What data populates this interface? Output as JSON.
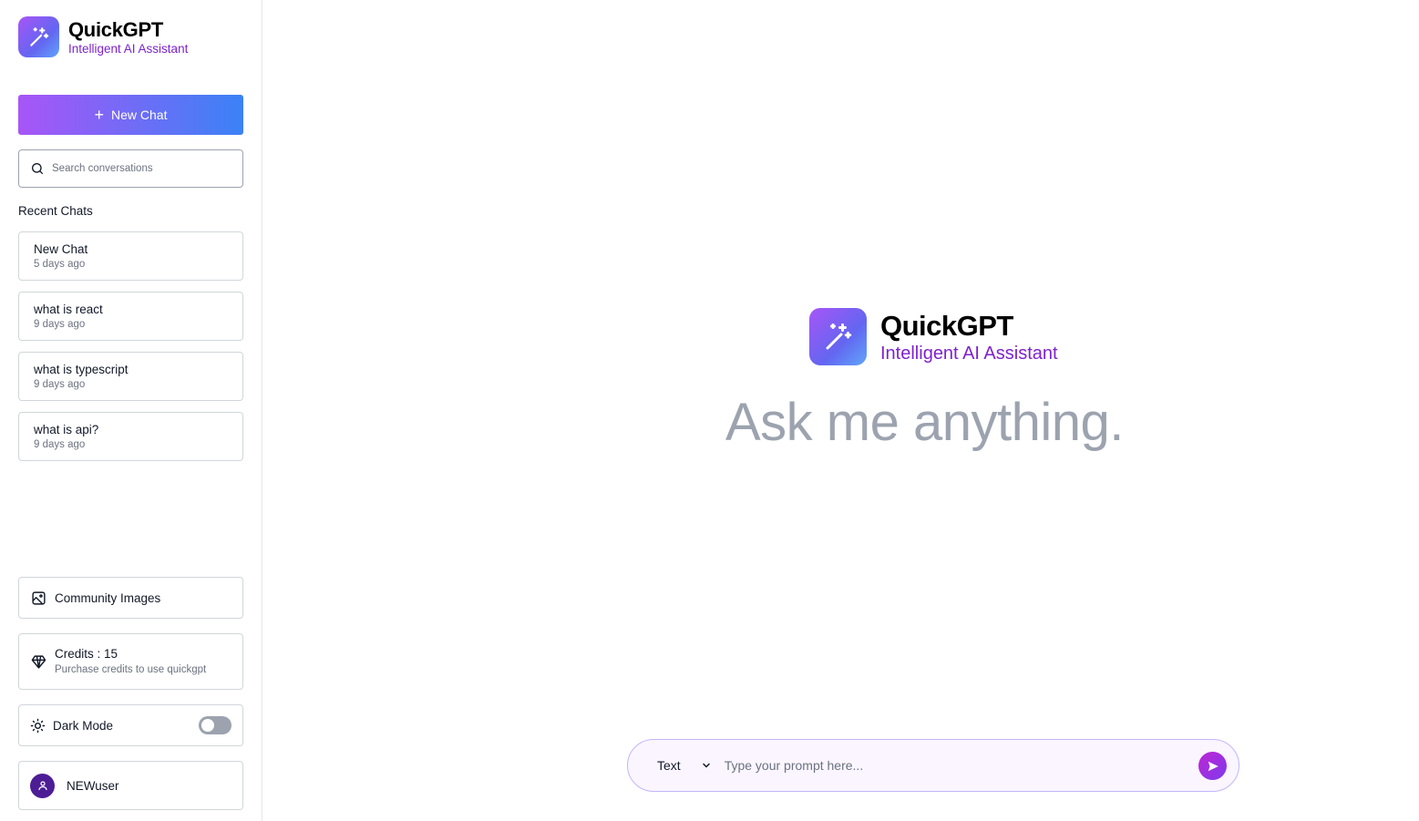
{
  "brand": {
    "title": "QuickGPT",
    "subtitle": "Intelligent AI Assistant",
    "icon": "magic-wand-icon"
  },
  "sidebar": {
    "new_chat_label": "New Chat",
    "search_placeholder": "Search conversations",
    "recent_label": "Recent Chats",
    "chats": [
      {
        "title": "New Chat",
        "time": "5 days ago"
      },
      {
        "title": "what is react",
        "time": "9 days ago"
      },
      {
        "title": "what is typescript",
        "time": "9 days ago"
      },
      {
        "title": "what is api?",
        "time": "9 days ago"
      }
    ],
    "community_label": "Community Images",
    "credits_label": "Credits : 15",
    "credits_sub": "Purchase credits to use quickgpt",
    "dark_mode_label": "Dark Mode",
    "dark_mode_on": false,
    "user_name": "NEWuser"
  },
  "main": {
    "hero_title": "QuickGPT",
    "hero_subtitle": "Intelligent AI Assistant",
    "hero_prompt": "Ask me anything.",
    "mode_value": "Text",
    "prompt_placeholder": "Type your prompt here..."
  },
  "colors": {
    "accent_purple": "#a855f7",
    "accent_blue": "#3b82f6",
    "subtitle_purple": "#7e22ce",
    "muted": "#9ca3af"
  }
}
